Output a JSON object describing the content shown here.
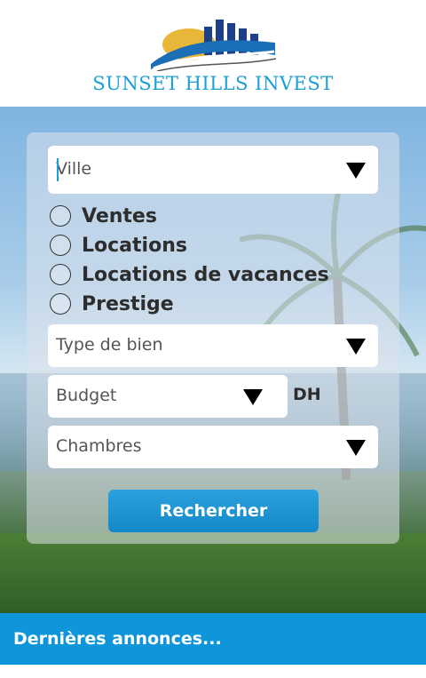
{
  "brand": {
    "name": "SUNSET HILLS INVEST",
    "colors": {
      "primary": "#1a9fd6",
      "navy": "#1e3f8a",
      "sun": "#e8b73a"
    }
  },
  "search": {
    "city_placeholder": "Ville",
    "options": [
      {
        "label": "Ventes",
        "checked": false
      },
      {
        "label": "Locations",
        "checked": false
      },
      {
        "label": "Locations de vacances",
        "checked": false
      },
      {
        "label": "Prestige",
        "checked": false
      }
    ],
    "property_type_label": "Type de bien",
    "budget_label": "Budget",
    "currency": "DH",
    "bedrooms_label": "Chambres",
    "submit_label": "Rechercher"
  },
  "footer": {
    "latest_listings": "Dernières annonces..."
  }
}
